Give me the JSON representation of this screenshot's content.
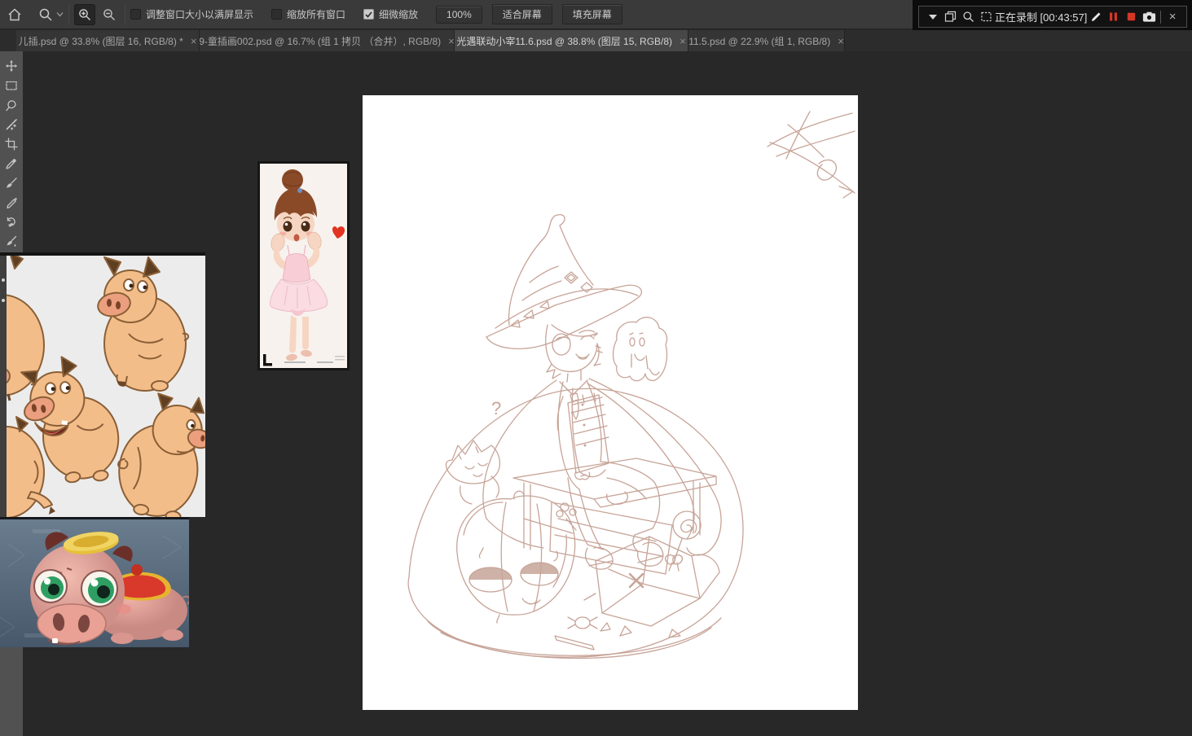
{
  "options_bar": {
    "resize_windows_label": "调整窗口大小以满屏显示",
    "zoom_all_label": "缩放所有窗口",
    "fine_zoom_label": "细微缩放",
    "zoom_value": "100%",
    "fit_screen_label": "适合屏幕",
    "fill_screen_label": "填充屏幕"
  },
  "recorder": {
    "status": "正在录制 [00:43:57]"
  },
  "tabs": [
    {
      "label": "儿插.psd @ 33.8% (图层 16, RGB/8) *",
      "active": false
    },
    {
      "label": "9-童插画002.psd @ 16.7% (组 1 拷贝 （合并）, RGB/8)",
      "active": false
    },
    {
      "label": "光遇联动小宰11.6.psd @ 38.8% (图层 15, RGB/8)",
      "active": true
    },
    {
      "label": "11.5.psd @ 22.9% (组 1, RGB/8)",
      "active": false
    }
  ],
  "glyphs": {
    "close": "×",
    "question_mark": "?"
  },
  "tools": [
    "move",
    "rectangular-marquee",
    "lasso",
    "magic-wand",
    "crop",
    "eyedropper",
    "brush",
    "pencil",
    "history-brush",
    "mixer-brush"
  ],
  "colors": {
    "options_bar_bg": "#3a3a3a",
    "pasteboard_bg": "#282828",
    "active_tab_bg": "#474747",
    "record_red": "#d23726",
    "sketch_stroke": "#c7a498",
    "pig_tan": "#f3bd8a",
    "pig3d_pink": "#e8a9a0",
    "coin_gold": "#e6c13a",
    "eye_green": "#2f9e62",
    "tutu_pink": "#fadce2"
  }
}
